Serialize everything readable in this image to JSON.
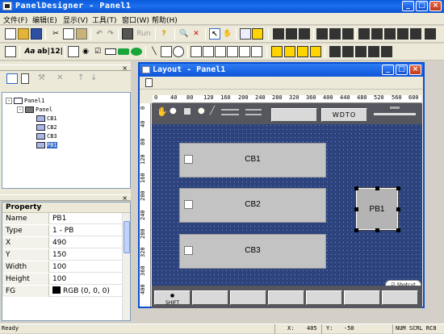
{
  "app": {
    "title": "PanelDesigner - Panel1"
  },
  "menu": [
    "文件(F)",
    "编辑(E)",
    "显示(V)",
    "工具(T)",
    "窗口(W)",
    "帮助(H)"
  ],
  "toolbar": {
    "run_label": "Run",
    "text_a": "Aa",
    "text_ab": "ab|",
    "text_12": "12|"
  },
  "tree": {
    "root": "Panel1",
    "child": "Panel",
    "items": [
      "CB1",
      "CB2",
      "CB3",
      "PB1"
    ],
    "selected": "PB1"
  },
  "property": {
    "title": "Property",
    "rows": [
      {
        "k": "Name",
        "v": "PB1"
      },
      {
        "k": "Type",
        "v": "1 - PB"
      },
      {
        "k": "X",
        "v": "490"
      },
      {
        "k": "Y",
        "v": "150"
      },
      {
        "k": "Width",
        "v": "100"
      },
      {
        "k": "Height",
        "v": "100"
      },
      {
        "k": "FG",
        "v": "RGB (0, 0, 0)"
      }
    ]
  },
  "layout": {
    "title": "Layout - Panel1",
    "ruler_top": [
      "0",
      "40",
      "80",
      "120",
      "160",
      "200",
      "240",
      "280",
      "320",
      "360",
      "400",
      "440",
      "480",
      "520",
      "560",
      "600"
    ],
    "ruler_left": [
      "0",
      "40",
      "80",
      "120",
      "160",
      "200",
      "240",
      "280",
      "320",
      "360",
      "400"
    ],
    "wdto_label": "WDTO",
    "controls": {
      "cb1": "CB1",
      "cb2": "CB2",
      "cb3": "CB3",
      "pb1": "PB1"
    },
    "shift_label": "SHIFT",
    "shotcut_label": "Shotcut"
  },
  "status": {
    "ready": "Ready",
    "x_label": "X:",
    "x_value": "405",
    "y_label": "Y:",
    "y_value": "-50",
    "indicators": "NUM SCRL RC8"
  }
}
